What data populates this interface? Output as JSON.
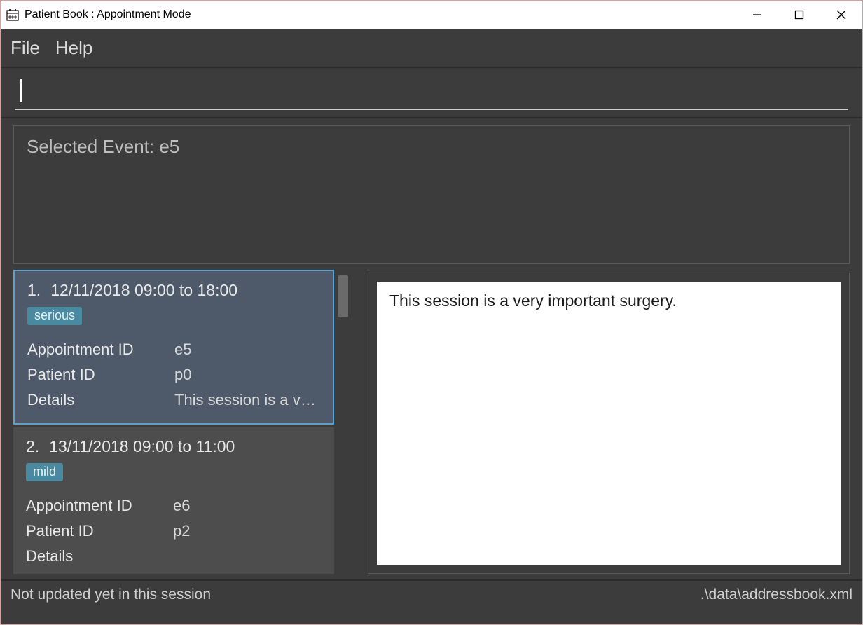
{
  "window": {
    "title": "Patient Book : Appointment Mode"
  },
  "menubar": {
    "file": "File",
    "help": "Help"
  },
  "command_input": {
    "value": "",
    "placeholder": ""
  },
  "selected_panel": {
    "text": "Selected Event: e5"
  },
  "appointments": [
    {
      "index": "1.",
      "daterange": "12/11/2018 09:00 to 18:00",
      "severity": "serious",
      "appointment_id_label": "Appointment ID",
      "appointment_id": "e5",
      "patient_id_label": "Patient ID",
      "patient_id": "p0",
      "details_label": "Details",
      "details_truncated": "This session is a very i...",
      "selected": true
    },
    {
      "index": "2.",
      "daterange": "13/11/2018 09:00 to 11:00",
      "severity": "mild",
      "appointment_id_label": "Appointment ID",
      "appointment_id": "e6",
      "patient_id_label": "Patient ID",
      "patient_id": "p2",
      "details_label": "Details",
      "details_truncated": "",
      "selected": false
    }
  ],
  "detail_pane": {
    "text": "This session is a very important surgery."
  },
  "statusbar": {
    "left": "Not updated yet in this session",
    "right": ".\\data\\addressbook.xml"
  }
}
